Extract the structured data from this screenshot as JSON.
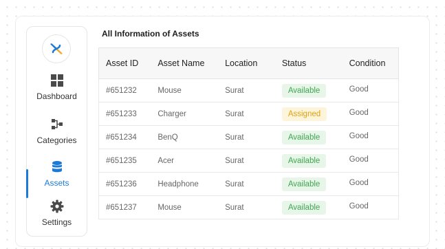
{
  "sidebar": {
    "items": [
      {
        "label": "Dashboard",
        "icon": "grid-icon"
      },
      {
        "label": "Categories",
        "icon": "hierarchy-icon"
      },
      {
        "label": "Assets",
        "icon": "database-icon",
        "active": true
      },
      {
        "label": "Settings",
        "icon": "gear-icon"
      }
    ]
  },
  "main": {
    "title": "All Information of Assets",
    "columns": [
      "Asset ID",
      "Asset Name",
      "Location",
      "Status",
      "Condition"
    ],
    "rows": [
      {
        "id": "#651232",
        "name": "Mouse",
        "location": "Surat",
        "status": "Available",
        "condition": "Good"
      },
      {
        "id": "#651233",
        "name": "Charger",
        "location": "Surat",
        "status": "Assigned",
        "condition": "Good"
      },
      {
        "id": "#651234",
        "name": "BenQ",
        "location": "Surat",
        "status": "Available",
        "condition": "Good"
      },
      {
        "id": "#651235",
        "name": "Acer",
        "location": "Surat",
        "status": "Available",
        "condition": "Good"
      },
      {
        "id": "#651236",
        "name": "Headphone",
        "location": "Surat",
        "status": "Available",
        "condition": "Good"
      },
      {
        "id": "#651237",
        "name": "Mouse",
        "location": "Surat",
        "status": "Available",
        "condition": "Good"
      }
    ]
  },
  "colors": {
    "accent": "#1c79d8",
    "available_bg": "#e8f6ea",
    "available_text": "#3fa54f",
    "assigned_bg": "#fdf4dc",
    "assigned_text": "#e0a20e"
  }
}
